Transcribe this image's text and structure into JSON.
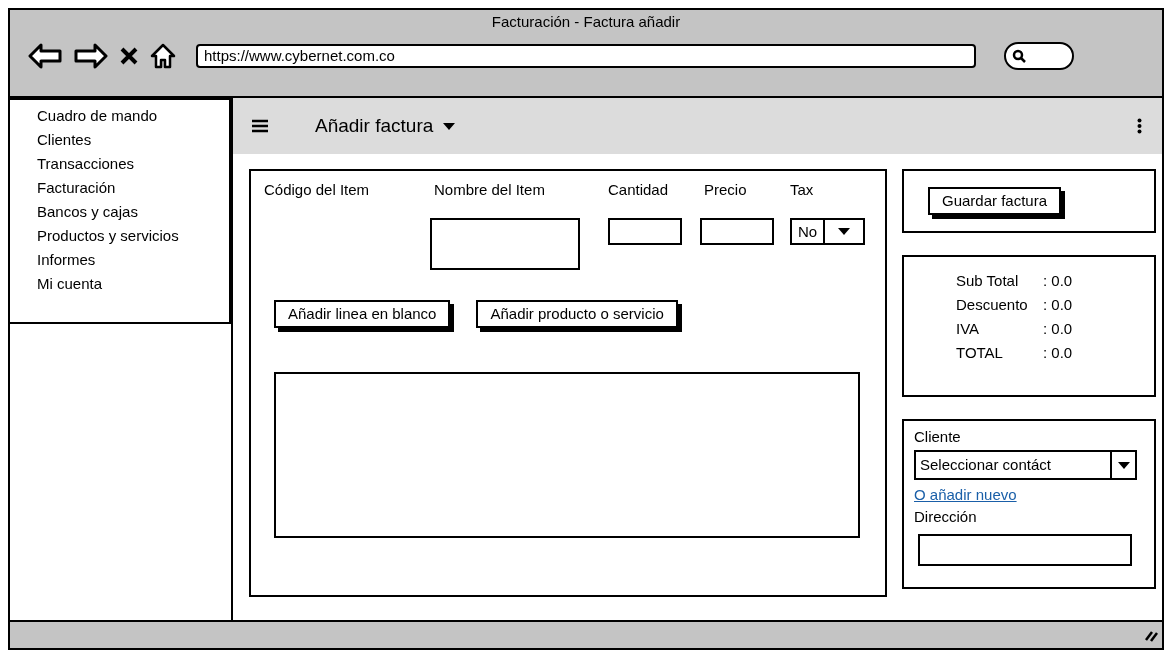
{
  "window": {
    "title": "Facturación - Factura añadir",
    "url": "https://www.cybernet.com.co"
  },
  "sidebar": {
    "items": [
      "Cuadro de mando",
      "Clientes",
      "Transacciones",
      "Facturación",
      "Bancos y cajas",
      "Productos y servicios",
      "Informes",
      "Mi cuenta"
    ]
  },
  "header": {
    "title": "Añadir factura"
  },
  "item_form": {
    "columns": [
      "Código del Item",
      "Nombre del Item",
      "Cantidad",
      "Precio",
      "Tax"
    ],
    "tax_select": {
      "value": "No"
    }
  },
  "buttons": [
    "Añadir linea en blanco",
    "Añadir producto o servicio"
  ],
  "save_button": "Guardar factura",
  "totals": [
    {
      "label": "Sub Total",
      "value": ": 0.0"
    },
    {
      "label": "Descuento",
      "value": ": 0.0"
    },
    {
      "label": "IVA",
      "value": ": 0.0"
    },
    {
      "label": "TOTAL",
      "value": ": 0.0"
    }
  ],
  "client": {
    "label": "Cliente",
    "select_value": "Seleccionar contáct",
    "link": "O añadir nuevo",
    "address_label": "Dirección"
  }
}
